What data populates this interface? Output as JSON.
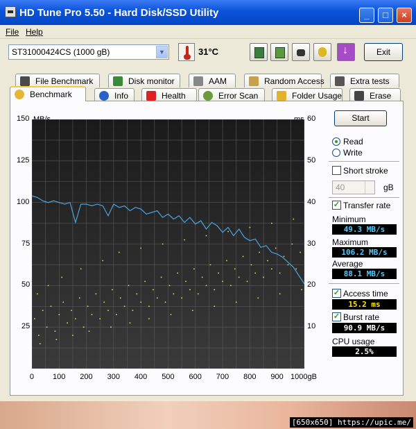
{
  "window": {
    "title": "HD Tune Pro 5.50 - Hard Disk/SSD Utility"
  },
  "menu": [
    "File",
    "Help"
  ],
  "toolbar": {
    "drive": "ST31000424CS (1000 gB)",
    "temperature": "31°C",
    "exit_label": "Exit"
  },
  "tabs_top": [
    {
      "label": "File Benchmark",
      "icon": "file-benchmark-icon"
    },
    {
      "label": "Disk monitor",
      "icon": "disk-monitor-icon"
    },
    {
      "label": "AAM",
      "icon": "speaker-icon"
    },
    {
      "label": "Random Access",
      "icon": "random-access-icon"
    },
    {
      "label": "Extra tests",
      "icon": "extra-tests-icon"
    }
  ],
  "tabs_bottom": [
    {
      "label": "Benchmark",
      "icon": "benchmark-icon"
    },
    {
      "label": "Info",
      "icon": "info-icon"
    },
    {
      "label": "Health",
      "icon": "health-icon"
    },
    {
      "label": "Error Scan",
      "icon": "magnifier-icon"
    },
    {
      "label": "Folder Usage",
      "icon": "folder-icon"
    },
    {
      "label": "Erase",
      "icon": "trash-icon"
    }
  ],
  "side": {
    "start_label": "Start",
    "read_label": "Read",
    "write_label": "Write",
    "short_stroke_label": "Short stroke",
    "short_stroke_value": "40",
    "short_stroke_unit": "gB",
    "transfer_rate_label": "Transfer rate",
    "minimum_label": "Minimum",
    "minimum_value": "49.3 MB/s",
    "maximum_label": "Maximum",
    "maximum_value": "106.2 MB/s",
    "average_label": "Average",
    "average_value": "88.1 MB/s",
    "access_time_label": "Access time",
    "access_time_value": "15.2 ms",
    "burst_rate_label": "Burst rate",
    "burst_rate_value": "90.9 MB/s",
    "cpu_label": "CPU usage",
    "cpu_value": "2.5%"
  },
  "colors": {
    "transfer_line": "#4aa3df",
    "access_points": "#e6e22a",
    "value_transfer": "#5ac8fa",
    "value_access": "#ffe600",
    "value_burst": "#ffffff"
  },
  "watermark": "[650x650] https://upic.me/",
  "chart_data": {
    "type": "line",
    "y_left_unit": "MB/s",
    "y_right_unit": "ms",
    "x_ticks": [
      "0",
      "100",
      "200",
      "300",
      "400",
      "500",
      "600",
      "700",
      "800",
      "900",
      "1000gB"
    ],
    "y_left_ticks": [
      "150",
      "125",
      "100",
      "75",
      "50",
      "25"
    ],
    "y_right_ticks": [
      "60",
      "50",
      "40",
      "30",
      "20",
      "10"
    ],
    "xlim": [
      0,
      1000
    ],
    "ylim_left": [
      0,
      150
    ],
    "ylim_right": [
      0,
      60
    ],
    "grid": true,
    "series": [
      {
        "name": "Transfer rate",
        "axis": "left",
        "x": [
          0,
          20,
          40,
          60,
          80,
          100,
          120,
          140,
          160,
          180,
          200,
          220,
          240,
          260,
          280,
          300,
          320,
          340,
          360,
          380,
          400,
          420,
          440,
          460,
          480,
          500,
          520,
          540,
          560,
          580,
          600,
          620,
          640,
          660,
          680,
          700,
          720,
          740,
          760,
          780,
          800,
          820,
          840,
          860,
          880,
          900,
          920,
          940,
          960,
          980,
          1000
        ],
        "y": [
          104,
          103,
          101,
          100,
          101,
          100,
          99,
          100,
          88,
          99,
          99,
          98,
          99,
          98,
          92,
          99,
          97,
          98,
          95,
          97,
          96,
          93,
          94,
          95,
          91,
          93,
          90,
          92,
          88,
          91,
          87,
          89,
          84,
          88,
          86,
          82,
          85,
          80,
          84,
          79,
          77,
          78,
          73,
          74,
          70,
          69,
          67,
          64,
          61,
          56,
          51
        ]
      },
      {
        "name": "Access time",
        "axis": "right",
        "type": "scatter",
        "points": [
          [
            10,
            12
          ],
          [
            25,
            8
          ],
          [
            40,
            14
          ],
          [
            55,
            10
          ],
          [
            70,
            15
          ],
          [
            85,
            9
          ],
          [
            100,
            13
          ],
          [
            115,
            16
          ],
          [
            130,
            11
          ],
          [
            145,
            14
          ],
          [
            160,
            12
          ],
          [
            175,
            17
          ],
          [
            190,
            10
          ],
          [
            205,
            15
          ],
          [
            220,
            13
          ],
          [
            235,
            18
          ],
          [
            250,
            12
          ],
          [
            265,
            16
          ],
          [
            280,
            14
          ],
          [
            295,
            19
          ],
          [
            310,
            13
          ],
          [
            325,
            17
          ],
          [
            340,
            15
          ],
          [
            355,
            20
          ],
          [
            370,
            14
          ],
          [
            385,
            18
          ],
          [
            400,
            16
          ],
          [
            415,
            21
          ],
          [
            430,
            15
          ],
          [
            445,
            19
          ],
          [
            460,
            17
          ],
          [
            475,
            22
          ],
          [
            490,
            16
          ],
          [
            505,
            20
          ],
          [
            520,
            18
          ],
          [
            535,
            23
          ],
          [
            550,
            17
          ],
          [
            565,
            21
          ],
          [
            580,
            19
          ],
          [
            595,
            24
          ],
          [
            610,
            18
          ],
          [
            625,
            22
          ],
          [
            640,
            20
          ],
          [
            655,
            25
          ],
          [
            670,
            19
          ],
          [
            685,
            23
          ],
          [
            700,
            21
          ],
          [
            715,
            26
          ],
          [
            730,
            20
          ],
          [
            745,
            24
          ],
          [
            760,
            22
          ],
          [
            775,
            27
          ],
          [
            790,
            21
          ],
          [
            805,
            25
          ],
          [
            820,
            23
          ],
          [
            835,
            28
          ],
          [
            850,
            22
          ],
          [
            865,
            26
          ],
          [
            880,
            24
          ],
          [
            895,
            29
          ],
          [
            910,
            23
          ],
          [
            925,
            27
          ],
          [
            940,
            25
          ],
          [
            955,
            30
          ],
          [
            970,
            24
          ],
          [
            985,
            28
          ],
          [
            20,
            18
          ],
          [
            60,
            20
          ],
          [
            110,
            22
          ],
          [
            180,
            24
          ],
          [
            260,
            26
          ],
          [
            320,
            28
          ],
          [
            400,
            29
          ],
          [
            480,
            30
          ],
          [
            560,
            31
          ],
          [
            640,
            32
          ],
          [
            720,
            33
          ],
          [
            800,
            34
          ],
          [
            880,
            35
          ],
          [
            960,
            36
          ],
          [
            30,
            6
          ],
          [
            90,
            7
          ],
          [
            150,
            8
          ],
          [
            210,
            9
          ],
          [
            290,
            10
          ],
          [
            360,
            11
          ],
          [
            430,
            12
          ],
          [
            510,
            13
          ],
          [
            590,
            14
          ],
          [
            670,
            15
          ],
          [
            750,
            16
          ],
          [
            830,
            17
          ],
          [
            910,
            18
          ],
          [
            990,
            19
          ]
        ]
      }
    ]
  }
}
